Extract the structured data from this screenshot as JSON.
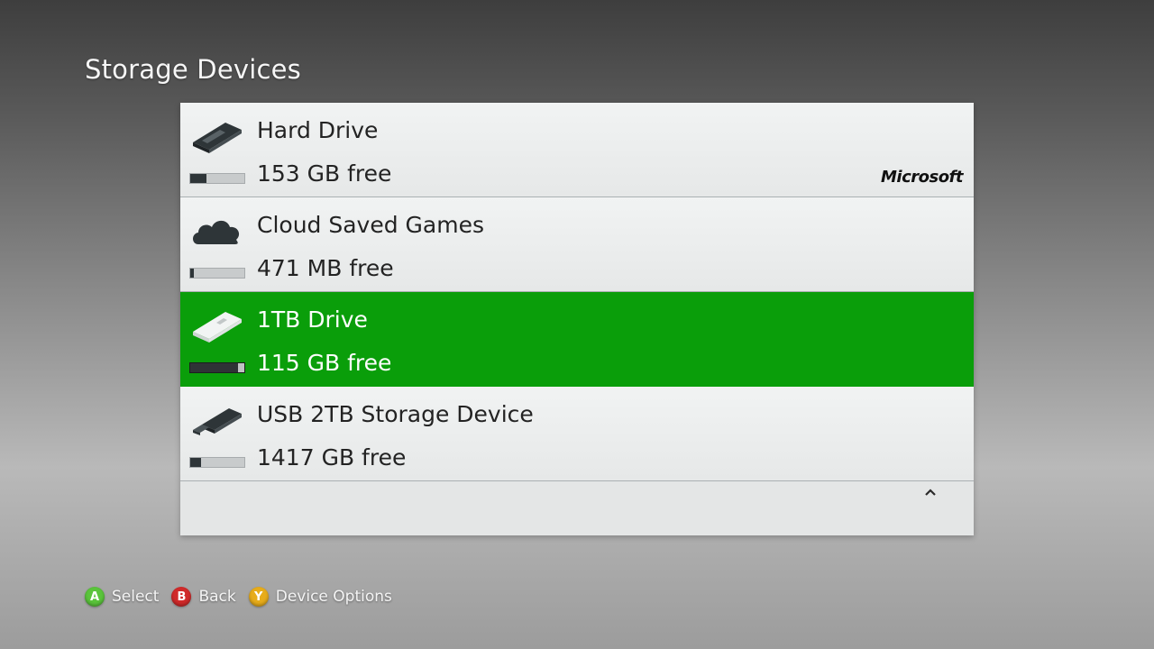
{
  "title": "Storage Devices",
  "devices": [
    {
      "name": "Hard Drive",
      "free": "153 GB free",
      "icon": "hard-drive-icon",
      "used_fraction": 0.3,
      "brand": "Microsoft",
      "selected": false
    },
    {
      "name": "Cloud Saved Games",
      "free": "471 MB free",
      "icon": "cloud-icon",
      "used_fraction": 0.06,
      "selected": false
    },
    {
      "name": "1TB Drive",
      "free": "115 GB free",
      "icon": "usb-drive-icon",
      "used_fraction": 0.88,
      "selected": true
    },
    {
      "name": "USB 2TB Storage Device",
      "free": "1417 GB free",
      "icon": "usb-stick-icon",
      "used_fraction": 0.2,
      "selected": false
    }
  ],
  "scroll_icon": "chevron-up-icon",
  "footer": {
    "a": {
      "key": "A",
      "label": "Select",
      "color": "#5ac43b"
    },
    "b": {
      "key": "B",
      "label": "Back",
      "color": "#d02a2a"
    },
    "y": {
      "key": "Y",
      "label": "Device Options",
      "color": "#e7ac1b"
    }
  },
  "colors": {
    "selected_row": "#0a9e0a",
    "panel": "#e4e6e6"
  }
}
